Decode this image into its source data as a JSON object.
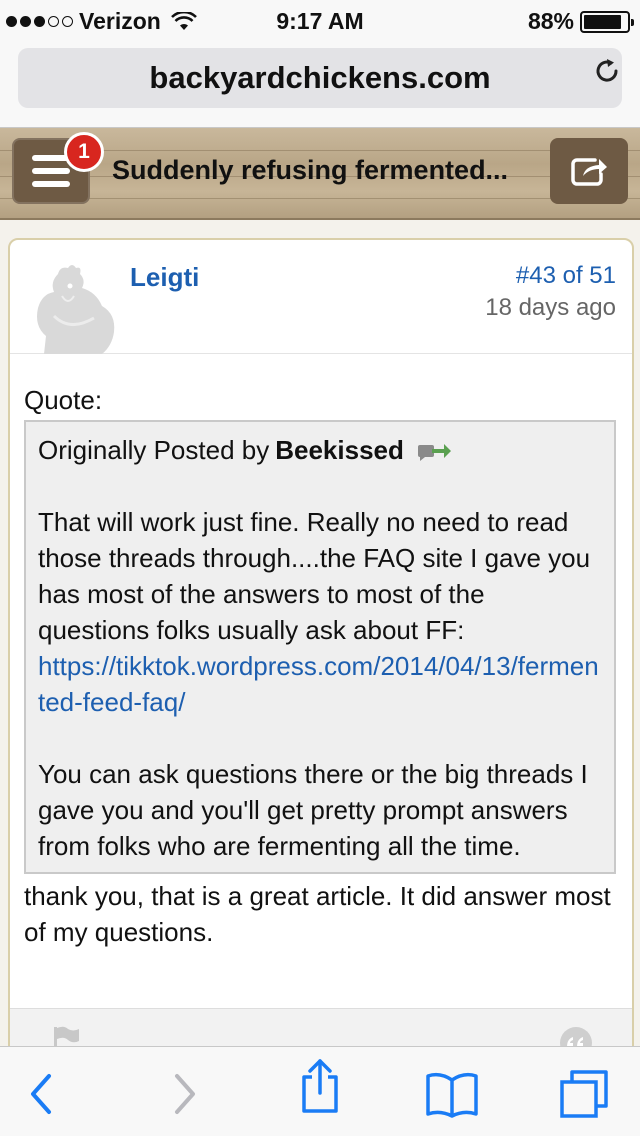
{
  "status_bar": {
    "carrier": "Verizon",
    "time": "9:17 AM",
    "battery": "88%",
    "battery_level": 0.88,
    "signal_bars_filled": 3,
    "signal_bars_total": 5
  },
  "browser": {
    "url": "backyardchickens.com",
    "reload_icon": "reload-icon"
  },
  "header": {
    "notification_count": "1",
    "thread_title": "Suddenly refusing fermented...",
    "menu_icon": "hamburger-icon",
    "share_icon": "share-icon"
  },
  "post": {
    "author": "Leigti",
    "post_number": "#43 of 51",
    "time_ago": "18 days ago",
    "quote_label": "Quote:",
    "quote": {
      "posted_by_prefix": "Originally Posted by",
      "posted_by_user": "Beekissed",
      "paragraph1": "That will work just fine.  Really no need to read those threads through....the FAQ site I gave you has most of the answers to most of the questions folks usually ask about FF:",
      "link": "https://tikktok.wordpress.com/2014/04/13/fermented-feed-faq/",
      "paragraph2": "You can ask questions there or the big threads I gave you and you'll get pretty prompt answers from folks who are fermenting all the time."
    },
    "reply": "thank you, that is a great article. It did answer most of my questions."
  },
  "colors": {
    "link": "#1d5fb0",
    "badge": "#d8261f",
    "wood_button": "#6e5a44",
    "ios_blue": "#1a7cf5"
  },
  "toolbar": {
    "back_icon": "back-chevron-icon",
    "forward_icon": "forward-chevron-icon",
    "share_icon": "share-icon",
    "bookmarks_icon": "bookmarks-icon",
    "tabs_icon": "tabs-icon"
  }
}
